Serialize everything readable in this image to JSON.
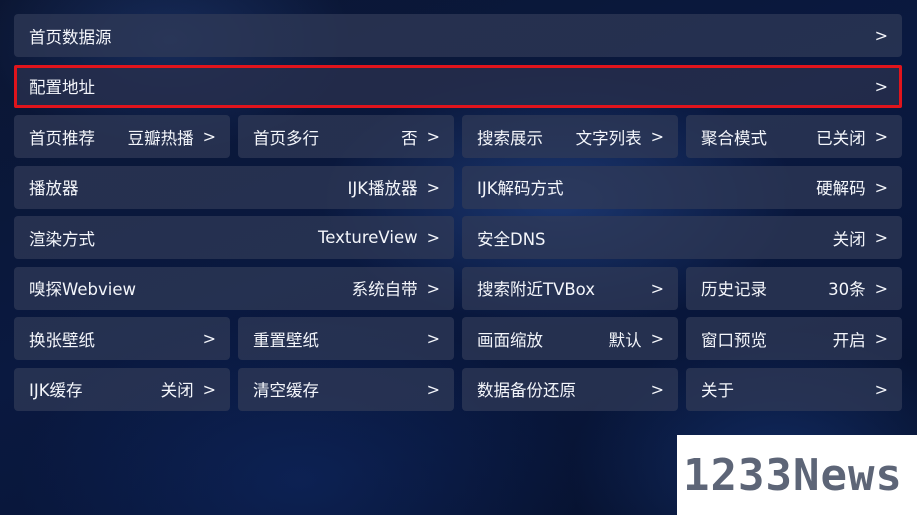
{
  "colors": {
    "tile_bg": "#303a58",
    "text": "#f4f6fb",
    "selection_border": "#e0141c",
    "watermark_text": "#5d6577"
  },
  "rows": [
    [
      {
        "label": "首页数据源",
        "value": "",
        "arrow": ">"
      }
    ],
    [
      {
        "label": "配置地址",
        "value": "",
        "arrow": ">",
        "selected": true
      }
    ],
    [
      {
        "label": "首页推荐",
        "value": "豆瓣热播",
        "arrow": ">"
      },
      {
        "label": "首页多行",
        "value": "否",
        "arrow": ">"
      },
      {
        "label": "搜索展示",
        "value": "文字列表",
        "arrow": ">"
      },
      {
        "label": "聚合模式",
        "value": "已关闭",
        "arrow": ">"
      }
    ],
    [
      {
        "label": "播放器",
        "value": "IJK播放器",
        "arrow": ">"
      },
      {
        "label": "IJK解码方式",
        "value": "硬解码",
        "arrow": ">"
      }
    ],
    [
      {
        "label": "渲染方式",
        "value": "TextureView",
        "arrow": ">"
      },
      {
        "label": "安全DNS",
        "value": "关闭",
        "arrow": ">"
      }
    ],
    [
      {
        "label": "嗅探Webview",
        "value": "系统自带",
        "arrow": ">"
      },
      {
        "label": "搜索附近TVBox",
        "value": "",
        "arrow": ">"
      },
      {
        "label": "历史记录",
        "value": "30条",
        "arrow": ">"
      }
    ],
    [
      {
        "label": "换张壁纸",
        "value": "",
        "arrow": ">"
      },
      {
        "label": "重置壁纸",
        "value": "",
        "arrow": ">"
      },
      {
        "label": "画面缩放",
        "value": "默认",
        "arrow": ">"
      },
      {
        "label": "窗口预览",
        "value": "开启",
        "arrow": ">"
      }
    ],
    [
      {
        "label": "IJK缓存",
        "value": "关闭",
        "arrow": ">"
      },
      {
        "label": "清空缓存",
        "value": "",
        "arrow": ">"
      },
      {
        "label": "数据备份还原",
        "value": "",
        "arrow": ">"
      },
      {
        "label": "关于",
        "value": "",
        "arrow": ">"
      }
    ]
  ],
  "watermark": {
    "text": "1233News"
  }
}
